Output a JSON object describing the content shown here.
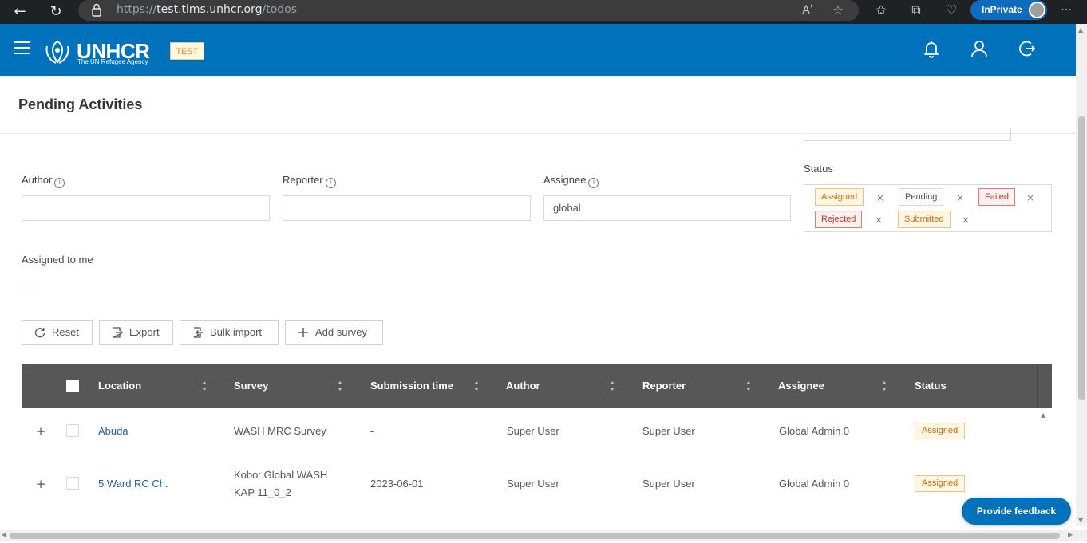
{
  "browser": {
    "url_prefix": "https://",
    "url_host": "test.tims.unhcr.org",
    "url_path": "/todos",
    "inprivate_label": "InPrivate",
    "read_aloud_glyph": "Aʹ"
  },
  "header": {
    "logo_brand": "UNHCR",
    "logo_sub": "The UN Refugee Agency",
    "env_badge": "TEST",
    "brand_color": "#0072bc"
  },
  "page": {
    "title": "Pending Activities"
  },
  "filters": {
    "author_label": "Author",
    "author_value": "",
    "reporter_label": "Reporter",
    "reporter_value": "",
    "assignee_label": "Assignee",
    "assignee_value": "global",
    "status_label": "Status",
    "status_tags": [
      "Assigned",
      "Pending",
      "Failed",
      "Rejected",
      "Submitted"
    ],
    "assigned_to_me_label": "Assigned to me",
    "info_glyph": "i",
    "remove_glyph": "×"
  },
  "toolbar": {
    "reset_label": "Reset",
    "export_label": "Export",
    "bulk_import_label": "Bulk import",
    "add_survey_label": "Add survey"
  },
  "table": {
    "columns": [
      "Location",
      "Survey",
      "Submission time",
      "Author",
      "Reporter",
      "Assignee",
      "Status"
    ],
    "expand_glyph": "+",
    "rows": [
      {
        "location": "Abuda",
        "survey_line1": "WASH MRC Survey",
        "survey_line2": "",
        "submission_time": "-",
        "author": "Super User",
        "reporter": "Super User",
        "assignee": "Global Admin 0",
        "status": "Assigned"
      },
      {
        "location": "5 Ward RC Ch.",
        "survey_line1": "Kobo: Global WASH",
        "survey_line2": "KAP 11_0_2",
        "submission_time": "2023-06-01",
        "author": "Super User",
        "reporter": "Super User",
        "assignee": "Global Admin 0",
        "status": "Assigned"
      }
    ]
  },
  "feedback": {
    "label": "Provide feedback"
  },
  "icons": {
    "back": "back-arrow-icon",
    "refresh": "refresh-icon",
    "lock": "lock-icon",
    "favorite": "star-icon",
    "favorites": "favorites-icon",
    "collections": "collections-icon",
    "health": "browser-essentials-icon",
    "more": "more-icon",
    "bell": "bell-icon",
    "user": "user-icon",
    "logout": "logout-icon",
    "back_glyph": "←",
    "refresh_glyph": "↻",
    "favorite_glyph": "☆",
    "favorites_glyph": "✩",
    "collections_glyph": "⧉",
    "health_glyph": "♡",
    "more_glyph": "···",
    "scroll_up_glyph": "▲",
    "scroll_down_glyph": "▼",
    "scroll_left_glyph": "◀",
    "scroll_right_glyph": "▶"
  }
}
